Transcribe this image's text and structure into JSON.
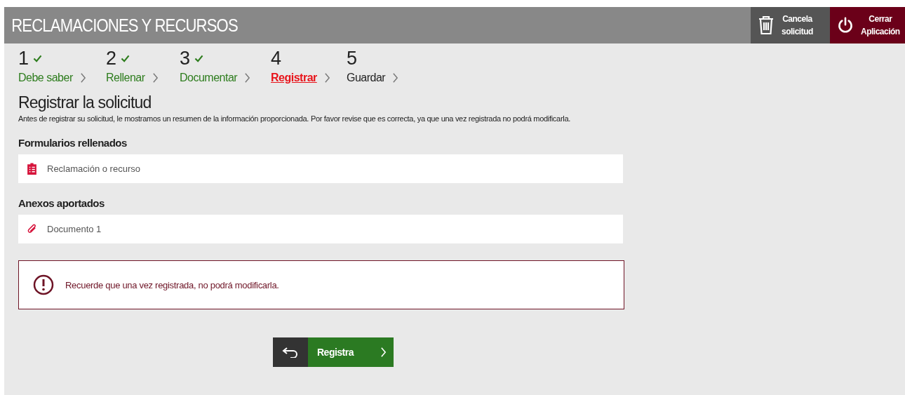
{
  "header": {
    "title": "RECLAMACIONES Y RECURSOS",
    "actions": [
      {
        "kind": "cancel",
        "label_1": "Cancela",
        "label_2": "solicitud"
      },
      {
        "kind": "close",
        "label_1": "Cerrar",
        "label_2": "Aplicación"
      }
    ]
  },
  "steps": [
    {
      "number": "1",
      "label": "Debe saber",
      "done": true,
      "selected": false
    },
    {
      "number": "2",
      "label": "Rellenar",
      "done": true,
      "selected": false
    },
    {
      "number": "3",
      "label": "Documentar",
      "done": true,
      "selected": false
    },
    {
      "number": "4",
      "label": "Registrar",
      "done": false,
      "selected": true
    },
    {
      "number": "5",
      "label": "Guardar",
      "done": false,
      "selected": false
    }
  ],
  "heading": "Registrar la solicitud",
  "intro": "Antes de registrar su solicitud, le mostramos un resumen de la información proporcionada. Por favor revise que es correcta, ya que una vez registrada no podrá modificarla.",
  "sections": [
    {
      "title": "Formularios rellenados",
      "items": [
        {
          "kind": "form",
          "label": "Reclamación o recurso"
        }
      ]
    },
    {
      "title": "Anexos aportados",
      "items": [
        {
          "kind": "attachment",
          "label": "Documento 1"
        }
      ]
    }
  ],
  "warning": "Recuerde que una vez registrada, no podrá modificarla.",
  "submit": {
    "label": "Registra"
  }
}
